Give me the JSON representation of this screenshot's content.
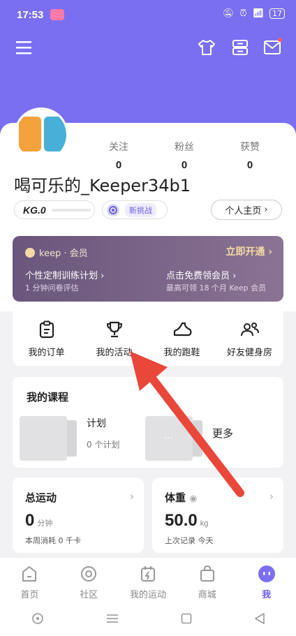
{
  "status": {
    "time": "17:53",
    "battery": "17"
  },
  "profile": {
    "username": "喝可乐的_Keeper34b1",
    "stats": [
      {
        "label": "关注",
        "value": "0"
      },
      {
        "label": "粉丝",
        "value": "0"
      },
      {
        "label": "获赞",
        "value": "0"
      }
    ],
    "kg_level": "KG.0",
    "challenge": "新挑战",
    "home_button": "个人主页"
  },
  "vip": {
    "brand": "keep · 会员",
    "open_label": "立即开通",
    "left_title": "个性定制训练计划",
    "left_sub": "1 分钟问卷评估",
    "right_title": "点击免费领会员",
    "right_sub": "最高可领 18 个月 Keep 会员"
  },
  "quick": [
    {
      "label": "我的订单",
      "icon": "clipboard-icon"
    },
    {
      "label": "我的活动",
      "icon": "trophy-icon"
    },
    {
      "label": "我的跑鞋",
      "icon": "shoe-icon"
    },
    {
      "label": "好友健身房",
      "icon": "friends-icon"
    }
  ],
  "courses": {
    "title": "我的课程",
    "plan_title": "计划",
    "plan_sub": "0 个计划",
    "more": "更多"
  },
  "cards": {
    "exercise": {
      "title": "总运动",
      "value": "0",
      "unit": "分钟",
      "sub": "本周消耗 0 千卡"
    },
    "weight": {
      "title": "体重",
      "value": "50.0",
      "unit": "kg",
      "sub": "上次记录 今天"
    }
  },
  "tabs": [
    {
      "label": "首页",
      "icon": "home-icon"
    },
    {
      "label": "社区",
      "icon": "community-icon"
    },
    {
      "label": "我的运动",
      "icon": "sport-icon"
    },
    {
      "label": "商城",
      "icon": "shop-icon"
    },
    {
      "label": "我",
      "icon": "me-icon"
    }
  ],
  "colors": {
    "accent": "#7a6ff0",
    "arrow": "#e9473a",
    "vip_bg": "#6a567c"
  }
}
